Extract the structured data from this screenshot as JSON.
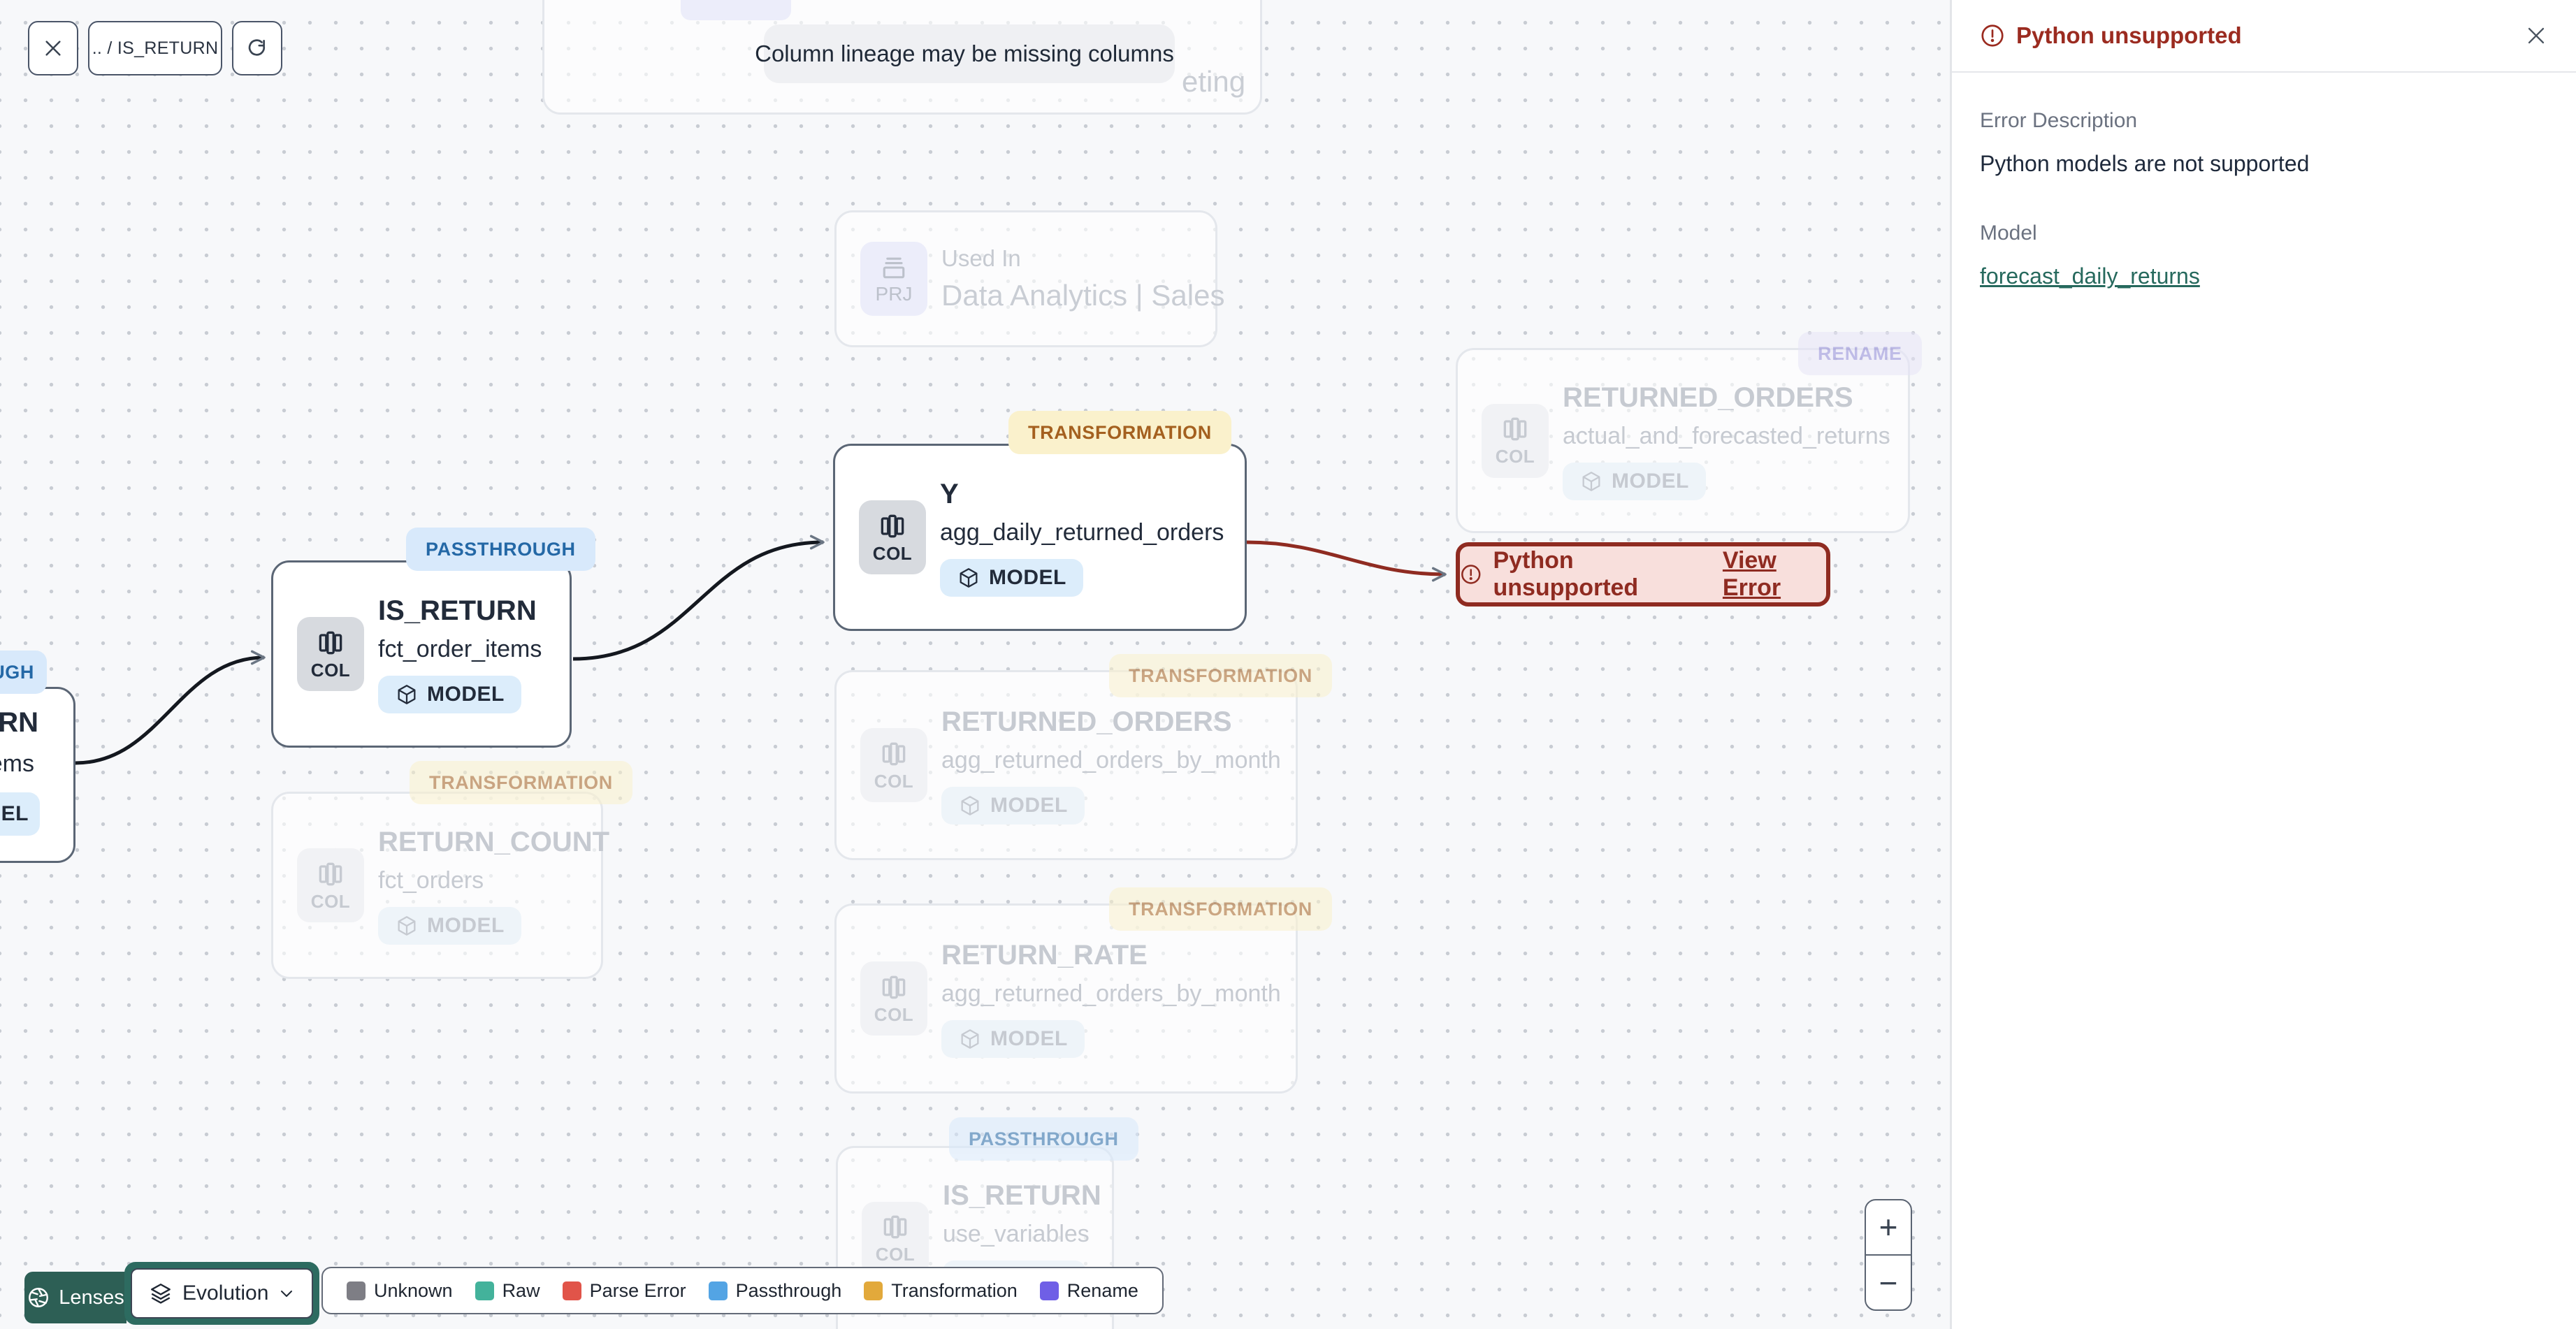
{
  "toolbar": {
    "breadcrumb": ".. / IS_RETURN"
  },
  "banner": {
    "text": "Column lineage may be missing columns"
  },
  "panel": {
    "title": "Python unsupported",
    "error_description_label": "Error Description",
    "error_description": "Python models are not supported",
    "model_label": "Model",
    "model_link": "forecast_daily_returns"
  },
  "chips": {
    "col": "COL",
    "model": "MODEL",
    "prj": "PRJ"
  },
  "badges": {
    "passthrough": "PASSTHROUGH",
    "transformation": "TRANSFORMATION",
    "rename": "RENAME"
  },
  "nodes": {
    "marketing_partial": {
      "subtitle_fragment": "eting"
    },
    "used_in": {
      "title": "Used In",
      "subtitle": "Data Analytics | Sales"
    },
    "renamed_returned_orders": {
      "title": "RETURNED_ORDERS",
      "subtitle": "actual_and_forecasted_returns"
    },
    "agg_daily_returned_orders": {
      "title": "Y",
      "subtitle": "agg_daily_returned_orders"
    },
    "fct_order_items": {
      "title": "IS_RETURN",
      "subtitle": "fct_order_items"
    },
    "left_partial": {
      "badge_fragment": "OUGH",
      "title_fragment": "URN",
      "subtitle_fragment": "ems",
      "model_fragment": "DEL"
    },
    "return_count": {
      "title": "RETURN_COUNT",
      "subtitle": "fct_orders"
    },
    "returned_orders_by_month": {
      "title": "RETURNED_ORDERS",
      "subtitle": "agg_returned_orders_by_month"
    },
    "return_rate": {
      "title": "RETURN_RATE",
      "subtitle": "agg_returned_orders_by_month"
    },
    "use_variables": {
      "title": "IS_RETURN",
      "subtitle": "use_variables"
    }
  },
  "error_node": {
    "label": "Python unsupported",
    "link_label": "View Error"
  },
  "footer": {
    "lenses_label": "Lenses",
    "lens_selected": "Evolution"
  },
  "legend": {
    "items": [
      {
        "label": "Unknown",
        "color": "#7E7E85"
      },
      {
        "label": "Raw",
        "color": "#43B29B"
      },
      {
        "label": "Parse Error",
        "color": "#E15449"
      },
      {
        "label": "Passthrough",
        "color": "#53A4E4"
      },
      {
        "label": "Transformation",
        "color": "#E2A93B"
      },
      {
        "label": "Rename",
        "color": "#6F5FE6"
      }
    ]
  },
  "zoom_controls": {
    "zoom_in": "+",
    "zoom_out": "−"
  },
  "colors": {
    "error": "#8F2B21",
    "error_bg": "#F8DFDC",
    "link_teal": "#26695D",
    "lenses_teal": "#2D5F55",
    "node_border": "#5B6675",
    "badge_transformation_bg": "#FAF1CC",
    "badge_transformation_text": "#A4601F",
    "badge_passthrough_bg": "#D8E9FB",
    "badge_passthrough_text": "#2468A6",
    "badge_rename_bg": "#E7E5F7"
  }
}
